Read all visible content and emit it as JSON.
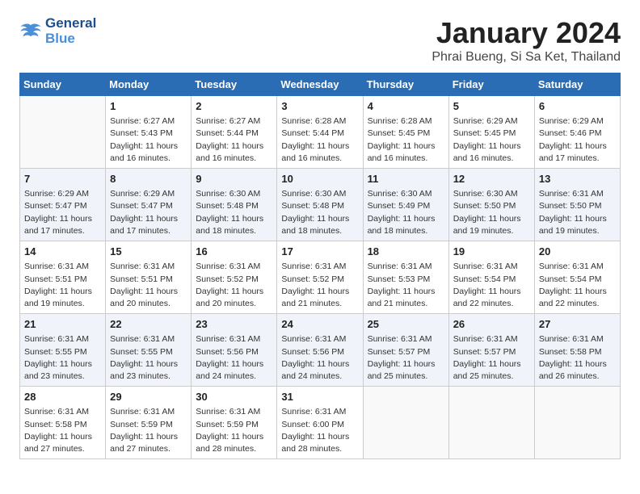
{
  "header": {
    "logo_line1": "General",
    "logo_line2": "Blue",
    "title": "January 2024",
    "subtitle": "Phrai Bueng, Si Sa Ket, Thailand"
  },
  "weekdays": [
    "Sunday",
    "Monday",
    "Tuesday",
    "Wednesday",
    "Thursday",
    "Friday",
    "Saturday"
  ],
  "weeks": [
    [
      {
        "day": "",
        "sunrise": "",
        "sunset": "",
        "daylight": ""
      },
      {
        "day": "1",
        "sunrise": "Sunrise: 6:27 AM",
        "sunset": "Sunset: 5:43 PM",
        "daylight": "Daylight: 11 hours and 16 minutes."
      },
      {
        "day": "2",
        "sunrise": "Sunrise: 6:27 AM",
        "sunset": "Sunset: 5:44 PM",
        "daylight": "Daylight: 11 hours and 16 minutes."
      },
      {
        "day": "3",
        "sunrise": "Sunrise: 6:28 AM",
        "sunset": "Sunset: 5:44 PM",
        "daylight": "Daylight: 11 hours and 16 minutes."
      },
      {
        "day": "4",
        "sunrise": "Sunrise: 6:28 AM",
        "sunset": "Sunset: 5:45 PM",
        "daylight": "Daylight: 11 hours and 16 minutes."
      },
      {
        "day": "5",
        "sunrise": "Sunrise: 6:29 AM",
        "sunset": "Sunset: 5:45 PM",
        "daylight": "Daylight: 11 hours and 16 minutes."
      },
      {
        "day": "6",
        "sunrise": "Sunrise: 6:29 AM",
        "sunset": "Sunset: 5:46 PM",
        "daylight": "Daylight: 11 hours and 17 minutes."
      }
    ],
    [
      {
        "day": "7",
        "sunrise": "Sunrise: 6:29 AM",
        "sunset": "Sunset: 5:47 PM",
        "daylight": "Daylight: 11 hours and 17 minutes."
      },
      {
        "day": "8",
        "sunrise": "Sunrise: 6:29 AM",
        "sunset": "Sunset: 5:47 PM",
        "daylight": "Daylight: 11 hours and 17 minutes."
      },
      {
        "day": "9",
        "sunrise": "Sunrise: 6:30 AM",
        "sunset": "Sunset: 5:48 PM",
        "daylight": "Daylight: 11 hours and 18 minutes."
      },
      {
        "day": "10",
        "sunrise": "Sunrise: 6:30 AM",
        "sunset": "Sunset: 5:48 PM",
        "daylight": "Daylight: 11 hours and 18 minutes."
      },
      {
        "day": "11",
        "sunrise": "Sunrise: 6:30 AM",
        "sunset": "Sunset: 5:49 PM",
        "daylight": "Daylight: 11 hours and 18 minutes."
      },
      {
        "day": "12",
        "sunrise": "Sunrise: 6:30 AM",
        "sunset": "Sunset: 5:50 PM",
        "daylight": "Daylight: 11 hours and 19 minutes."
      },
      {
        "day": "13",
        "sunrise": "Sunrise: 6:31 AM",
        "sunset": "Sunset: 5:50 PM",
        "daylight": "Daylight: 11 hours and 19 minutes."
      }
    ],
    [
      {
        "day": "14",
        "sunrise": "Sunrise: 6:31 AM",
        "sunset": "Sunset: 5:51 PM",
        "daylight": "Daylight: 11 hours and 19 minutes."
      },
      {
        "day": "15",
        "sunrise": "Sunrise: 6:31 AM",
        "sunset": "Sunset: 5:51 PM",
        "daylight": "Daylight: 11 hours and 20 minutes."
      },
      {
        "day": "16",
        "sunrise": "Sunrise: 6:31 AM",
        "sunset": "Sunset: 5:52 PM",
        "daylight": "Daylight: 11 hours and 20 minutes."
      },
      {
        "day": "17",
        "sunrise": "Sunrise: 6:31 AM",
        "sunset": "Sunset: 5:52 PM",
        "daylight": "Daylight: 11 hours and 21 minutes."
      },
      {
        "day": "18",
        "sunrise": "Sunrise: 6:31 AM",
        "sunset": "Sunset: 5:53 PM",
        "daylight": "Daylight: 11 hours and 21 minutes."
      },
      {
        "day": "19",
        "sunrise": "Sunrise: 6:31 AM",
        "sunset": "Sunset: 5:54 PM",
        "daylight": "Daylight: 11 hours and 22 minutes."
      },
      {
        "day": "20",
        "sunrise": "Sunrise: 6:31 AM",
        "sunset": "Sunset: 5:54 PM",
        "daylight": "Daylight: 11 hours and 22 minutes."
      }
    ],
    [
      {
        "day": "21",
        "sunrise": "Sunrise: 6:31 AM",
        "sunset": "Sunset: 5:55 PM",
        "daylight": "Daylight: 11 hours and 23 minutes."
      },
      {
        "day": "22",
        "sunrise": "Sunrise: 6:31 AM",
        "sunset": "Sunset: 5:55 PM",
        "daylight": "Daylight: 11 hours and 23 minutes."
      },
      {
        "day": "23",
        "sunrise": "Sunrise: 6:31 AM",
        "sunset": "Sunset: 5:56 PM",
        "daylight": "Daylight: 11 hours and 24 minutes."
      },
      {
        "day": "24",
        "sunrise": "Sunrise: 6:31 AM",
        "sunset": "Sunset: 5:56 PM",
        "daylight": "Daylight: 11 hours and 24 minutes."
      },
      {
        "day": "25",
        "sunrise": "Sunrise: 6:31 AM",
        "sunset": "Sunset: 5:57 PM",
        "daylight": "Daylight: 11 hours and 25 minutes."
      },
      {
        "day": "26",
        "sunrise": "Sunrise: 6:31 AM",
        "sunset": "Sunset: 5:57 PM",
        "daylight": "Daylight: 11 hours and 25 minutes."
      },
      {
        "day": "27",
        "sunrise": "Sunrise: 6:31 AM",
        "sunset": "Sunset: 5:58 PM",
        "daylight": "Daylight: 11 hours and 26 minutes."
      }
    ],
    [
      {
        "day": "28",
        "sunrise": "Sunrise: 6:31 AM",
        "sunset": "Sunset: 5:58 PM",
        "daylight": "Daylight: 11 hours and 27 minutes."
      },
      {
        "day": "29",
        "sunrise": "Sunrise: 6:31 AM",
        "sunset": "Sunset: 5:59 PM",
        "daylight": "Daylight: 11 hours and 27 minutes."
      },
      {
        "day": "30",
        "sunrise": "Sunrise: 6:31 AM",
        "sunset": "Sunset: 5:59 PM",
        "daylight": "Daylight: 11 hours and 28 minutes."
      },
      {
        "day": "31",
        "sunrise": "Sunrise: 6:31 AM",
        "sunset": "Sunset: 6:00 PM",
        "daylight": "Daylight: 11 hours and 28 minutes."
      },
      {
        "day": "",
        "sunrise": "",
        "sunset": "",
        "daylight": ""
      },
      {
        "day": "",
        "sunrise": "",
        "sunset": "",
        "daylight": ""
      },
      {
        "day": "",
        "sunrise": "",
        "sunset": "",
        "daylight": ""
      }
    ]
  ]
}
